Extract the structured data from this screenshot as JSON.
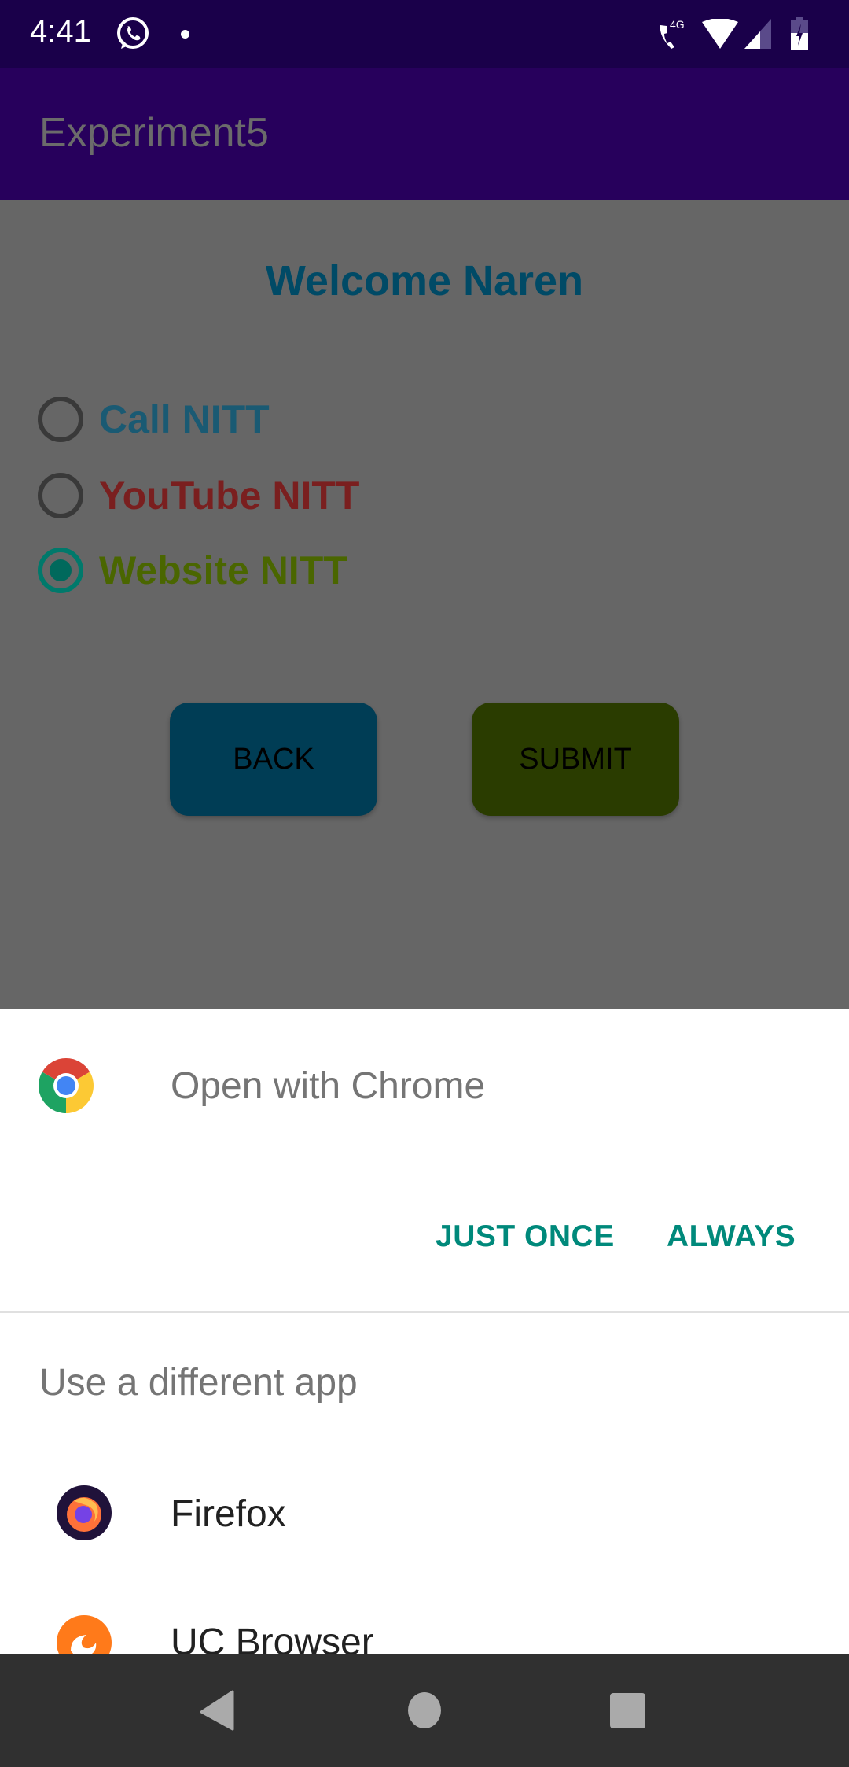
{
  "status_bar": {
    "time": "4:41",
    "icons": [
      "whatsapp-icon",
      "notification-dot-icon",
      "wifi-calling-4g-icon",
      "wifi-icon",
      "cell-signal-icon",
      "battery-charging-icon"
    ],
    "network_label": "4G"
  },
  "app_bar": {
    "title": "Experiment5"
  },
  "main": {
    "welcome": "Welcome Naren",
    "options": [
      {
        "label": "Call NITT",
        "color": "#1a5a73",
        "selected": false
      },
      {
        "label": "YouTube NITT",
        "color": "#7a1f1f",
        "selected": false
      },
      {
        "label": "Website NITT",
        "color": "#4a6600",
        "selected": true
      }
    ],
    "back_label": "BACK",
    "submit_label": "SUBMIT"
  },
  "chooser": {
    "title": "Open with Chrome",
    "just_once": "JUST ONCE",
    "always": "ALWAYS",
    "different_app": "Use a different app",
    "apps": [
      {
        "name": "Firefox",
        "icon": "firefox-icon"
      },
      {
        "name": "UC Browser",
        "icon": "uc-browser-icon"
      }
    ],
    "accent": "#00897b"
  },
  "nav_bar": {
    "buttons": [
      "back",
      "home",
      "recents"
    ]
  }
}
